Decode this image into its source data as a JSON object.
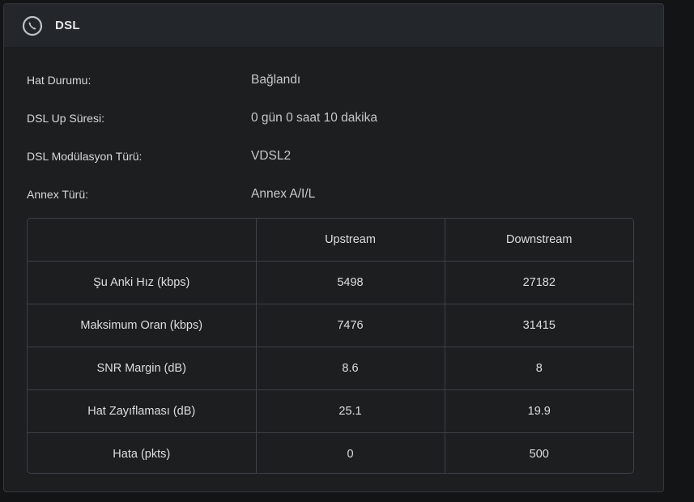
{
  "header": {
    "title": "DSL",
    "icon": "phone-icon"
  },
  "info": [
    {
      "label": "Hat Durumu:",
      "value": "Bağlandı"
    },
    {
      "label": "DSL Up Süresi:",
      "value": "0 gün 0 saat 10 dakika"
    },
    {
      "label": "DSL Modülasyon Türü:",
      "value": "VDSL2"
    },
    {
      "label": "Annex Türü:",
      "value": "Annex A/I/L"
    }
  ],
  "table": {
    "columns": [
      "",
      "Upstream",
      "Downstream"
    ],
    "rows": [
      {
        "label": "Şu Anki Hız (kbps)",
        "up": "5498",
        "down": "27182"
      },
      {
        "label": "Maksimum Oran (kbps)",
        "up": "7476",
        "down": "31415"
      },
      {
        "label": "SNR Margin (dB)",
        "up": "8.6",
        "down": "8"
      },
      {
        "label": "Hat Zayıflaması (dB)",
        "up": "25.1",
        "down": "19.9"
      },
      {
        "label": "Hata (pkts)",
        "up": "0",
        "down": "500"
      }
    ]
  }
}
